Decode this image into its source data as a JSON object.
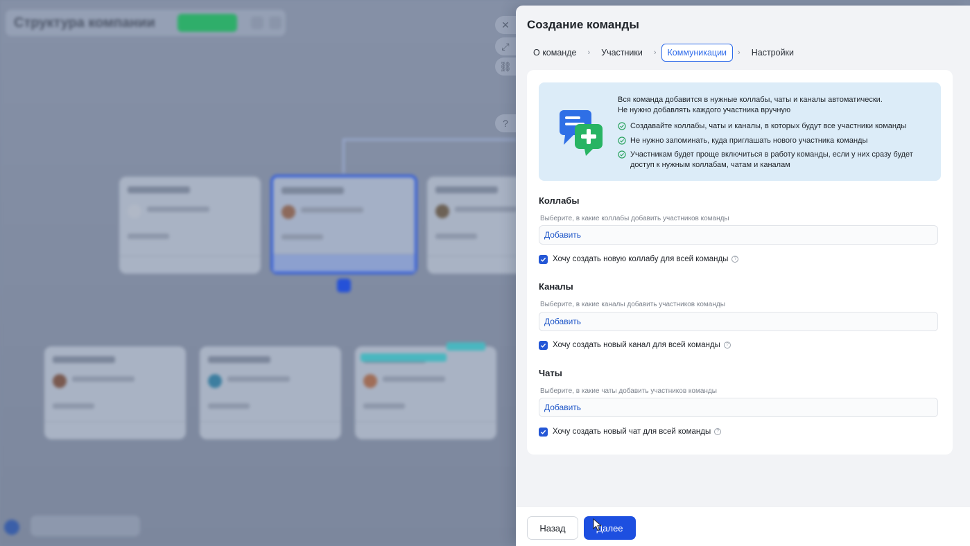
{
  "background": {
    "title": "Структура компании"
  },
  "panel": {
    "title": "Создание команды",
    "steps": [
      {
        "label": "О команде",
        "active": false
      },
      {
        "label": "Участники",
        "active": false
      },
      {
        "label": "Коммуникации",
        "active": true
      },
      {
        "label": "Настройки",
        "active": false
      }
    ],
    "banner": {
      "headline": "Вся команда добавится в нужные коллабы, чаты и каналы автоматически.",
      "subline": "Не нужно добавлять каждого участника вручную",
      "bullets": [
        "Создавайте коллабы, чаты и каналы, в которых будут все участники команды",
        "Не нужно запоминать, куда приглашать нового участника команды",
        "Участникам будет проще включиться в работу команды, если у них сразу будет доступ к нужным коллабам, чатам и каналам"
      ]
    },
    "sections": [
      {
        "title": "Коллабы",
        "hint": "Выберите, в какие коллабы добавить участников команды",
        "add_label": "Добавить",
        "checkbox_label": "Хочу создать новую коллабу для всей команды",
        "checked": true
      },
      {
        "title": "Каналы",
        "hint": "Выберите, в какие каналы добавить участников команды",
        "add_label": "Добавить",
        "checkbox_label": "Хочу создать новый канал для всей команды",
        "checked": true
      },
      {
        "title": "Чаты",
        "hint": "Выберите, в какие чаты добавить участников команды",
        "add_label": "Добавить",
        "checkbox_label": "Хочу создать новый чат для всей команды",
        "checked": true
      }
    ],
    "footer": {
      "back_label": "Назад",
      "next_label": "Далее"
    }
  },
  "colors": {
    "accent": "#1d4fe0",
    "banner_bg": "#dcecf8",
    "success": "#2fae6a"
  }
}
